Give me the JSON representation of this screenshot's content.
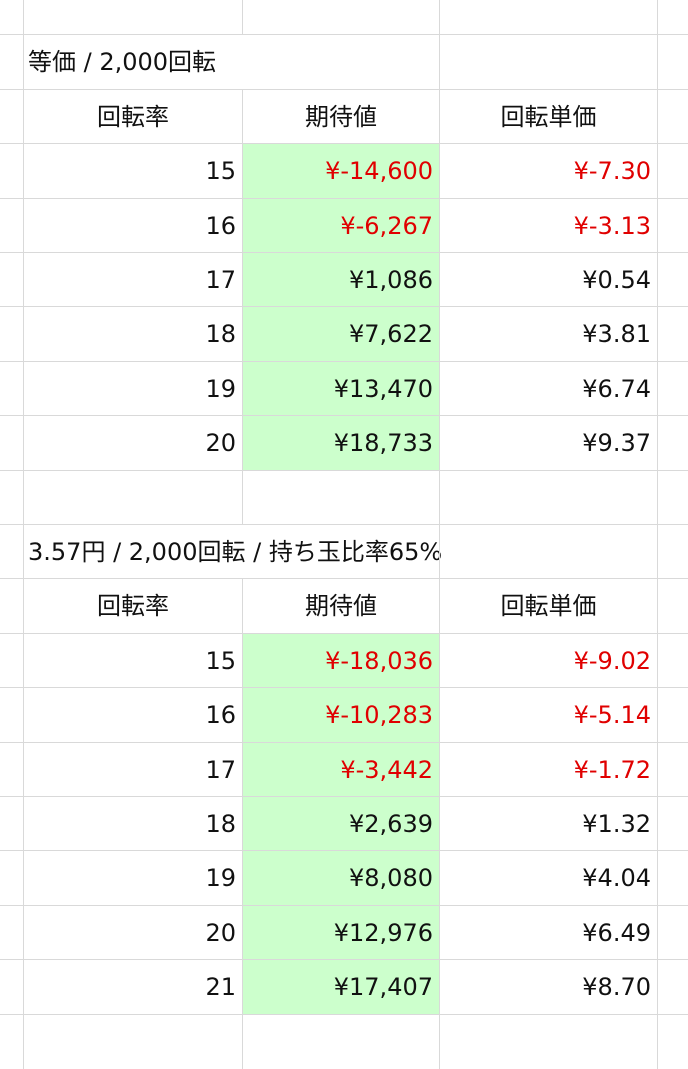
{
  "sections": [
    {
      "title": "等価 / 2,000回転",
      "headers": [
        "回転率",
        "期待値",
        "回転単価"
      ],
      "rows": [
        {
          "rate": "15",
          "ev": "¥-14,600",
          "unit": "¥-7.30",
          "neg": true
        },
        {
          "rate": "16",
          "ev": "¥-6,267",
          "unit": "¥-3.13",
          "neg": true
        },
        {
          "rate": "17",
          "ev": "¥1,086",
          "unit": "¥0.54",
          "neg": false
        },
        {
          "rate": "18",
          "ev": "¥7,622",
          "unit": "¥3.81",
          "neg": false
        },
        {
          "rate": "19",
          "ev": "¥13,470",
          "unit": "¥6.74",
          "neg": false
        },
        {
          "rate": "20",
          "ev": "¥18,733",
          "unit": "¥9.37",
          "neg": false
        }
      ]
    },
    {
      "title": "3.57円 / 2,000回転 / 持ち玉比率65%",
      "headers": [
        "回転率",
        "期待値",
        "回転単価"
      ],
      "rows": [
        {
          "rate": "15",
          "ev": "¥-18,036",
          "unit": "¥-9.02",
          "neg": true
        },
        {
          "rate": "16",
          "ev": "¥-10,283",
          "unit": "¥-5.14",
          "neg": true
        },
        {
          "rate": "17",
          "ev": "¥-3,442",
          "unit": "¥-1.72",
          "neg": true
        },
        {
          "rate": "18",
          "ev": "¥2,639",
          "unit": "¥1.32",
          "neg": false
        },
        {
          "rate": "19",
          "ev": "¥8,080",
          "unit": "¥4.04",
          "neg": false
        },
        {
          "rate": "20",
          "ev": "¥12,976",
          "unit": "¥6.49",
          "neg": false
        },
        {
          "rate": "21",
          "ev": "¥17,407",
          "unit": "¥8.70",
          "neg": false
        }
      ]
    }
  ]
}
